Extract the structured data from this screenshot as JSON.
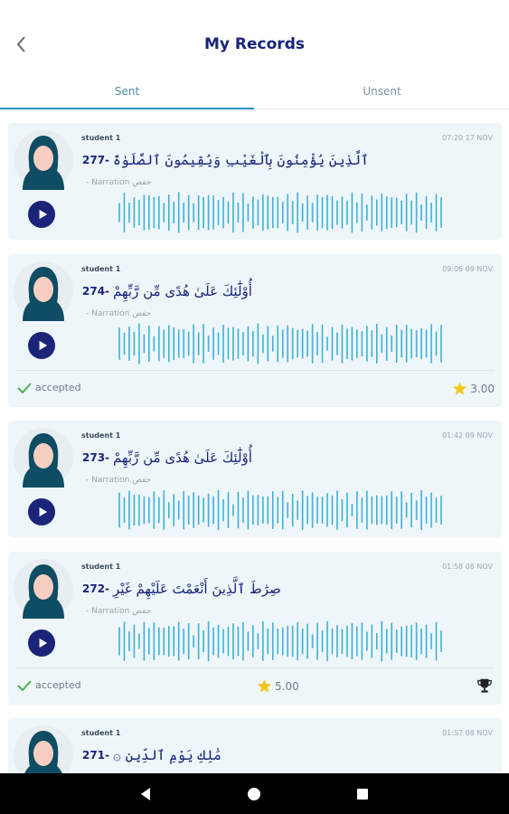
{
  "header": {
    "title": "My Records",
    "back_icon": "chevron-left-icon"
  },
  "tabs": [
    {
      "label": "Sent",
      "active": true
    },
    {
      "label": "Unsent",
      "active": false
    }
  ],
  "records": [
    {
      "student": "student 1",
      "time": "07:20 17 NOV",
      "verse_number": "277-",
      "verse_text": "ٱلَّذِينَ يُؤْمِنُونَ بِٱلْغَيْبِ وَيُقِيمُونَ ٱلصَّلَوٰةَ",
      "narration": "- Narration حفص",
      "status": null,
      "rating": null,
      "trophy": false
    },
    {
      "student": "student 1",
      "time": "09:06 09 NOV",
      "verse_number": "274-",
      "verse_text": "أُوْلَٰٓئِكَ عَلَىٰ هُدًى مِّن رَّبِّهِمْ",
      "narration": "- Narration حفص",
      "status": "accepted",
      "rating": "3.00",
      "trophy": false
    },
    {
      "student": "student 1",
      "time": "01:42 09 NOV",
      "verse_number": "273-",
      "verse_text": "أُوْلَٰٓئِكَ عَلَىٰ هُدًى مِّن رَّبِّهِمْ",
      "narration": "- Narration حفص",
      "status": null,
      "rating": null,
      "trophy": false
    },
    {
      "student": "student 1",
      "time": "01:58 08 NOV",
      "verse_number": "272-",
      "verse_text": "صِرَٰطَ ٱلَّذِينَ أَنْعَمْتَ عَلَيْهِمْ غَيْرِ",
      "narration": "- Narration حفص",
      "status": "accepted",
      "rating": "5.00",
      "trophy": true
    },
    {
      "student": "student 1",
      "time": "01:57 08 NOV",
      "verse_number": "271-",
      "verse_text": "مَٰلِكِ يَوْمِ ٱلدِّينِ ۞",
      "narration": "",
      "status": null,
      "rating": null,
      "trophy": false
    }
  ],
  "colors": {
    "primary": "#1a2478",
    "wave": "#3fb0d8",
    "card_bg": "#eef6f9",
    "accent": "#2d8fc0",
    "star": "#f2c81c",
    "check": "#4caf50"
  },
  "navbar": {
    "back": "back-triangle-icon",
    "home": "home-circle-icon",
    "recents": "recents-square-icon"
  }
}
